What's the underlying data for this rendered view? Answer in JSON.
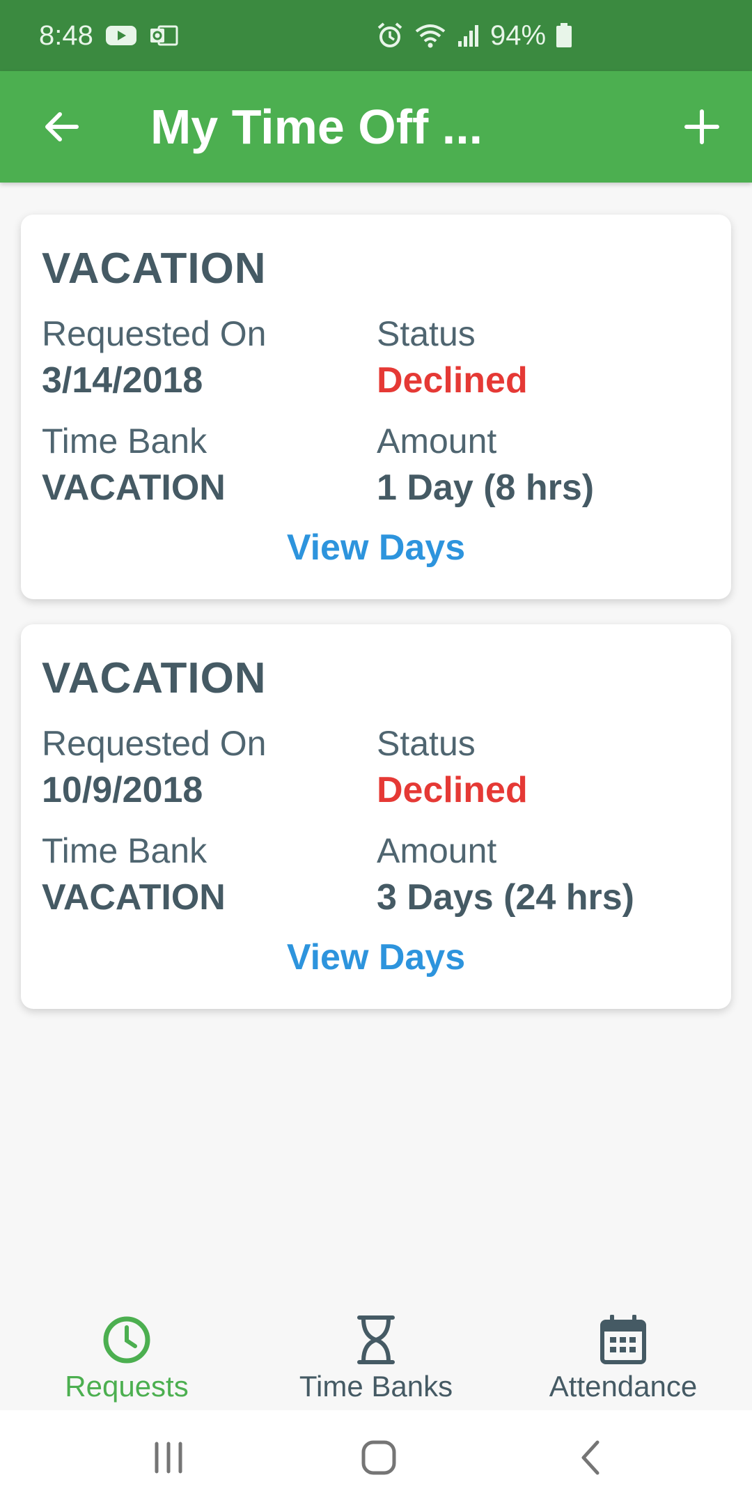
{
  "status_bar": {
    "time": "8:48",
    "left_icons": [
      "youtube-icon",
      "outlook-icon"
    ],
    "right_icons": [
      "alarm-icon",
      "wifi-icon",
      "signal-icon"
    ],
    "battery": "94%"
  },
  "app_bar": {
    "title": "My Time Off ...",
    "back_icon": "arrow-left-icon",
    "add_icon": "plus-icon"
  },
  "requests": [
    {
      "type": "VACATION",
      "requested_on_label": "Requested On",
      "requested_on": "3/14/2018",
      "status_label": "Status",
      "status": "Declined",
      "time_bank_label": "Time Bank",
      "time_bank": "VACATION",
      "amount_label": "Amount",
      "amount": "1 Day (8 hrs)",
      "action": "View Days"
    },
    {
      "type": "VACATION",
      "requested_on_label": "Requested On",
      "requested_on": "10/9/2018",
      "status_label": "Status",
      "status": "Declined",
      "time_bank_label": "Time Bank",
      "time_bank": "VACATION",
      "amount_label": "Amount",
      "amount": "3 Days (24 hrs)",
      "action": "View Days"
    }
  ],
  "bottom_nav": [
    {
      "label": "Requests",
      "icon": "clock-icon",
      "active": true
    },
    {
      "label": "Time Banks",
      "icon": "hourglass-icon",
      "active": false
    },
    {
      "label": "Attendance",
      "icon": "calendar-icon",
      "active": false
    }
  ],
  "system_nav": [
    "recents-icon",
    "home-icon",
    "back-icon"
  ],
  "colors": {
    "status_bar": "#3b8a40",
    "app_bar": "#4caf50",
    "declined": "#e53935",
    "link": "#2d94dd",
    "text": "#455a64",
    "active_tab": "#4caf50"
  }
}
